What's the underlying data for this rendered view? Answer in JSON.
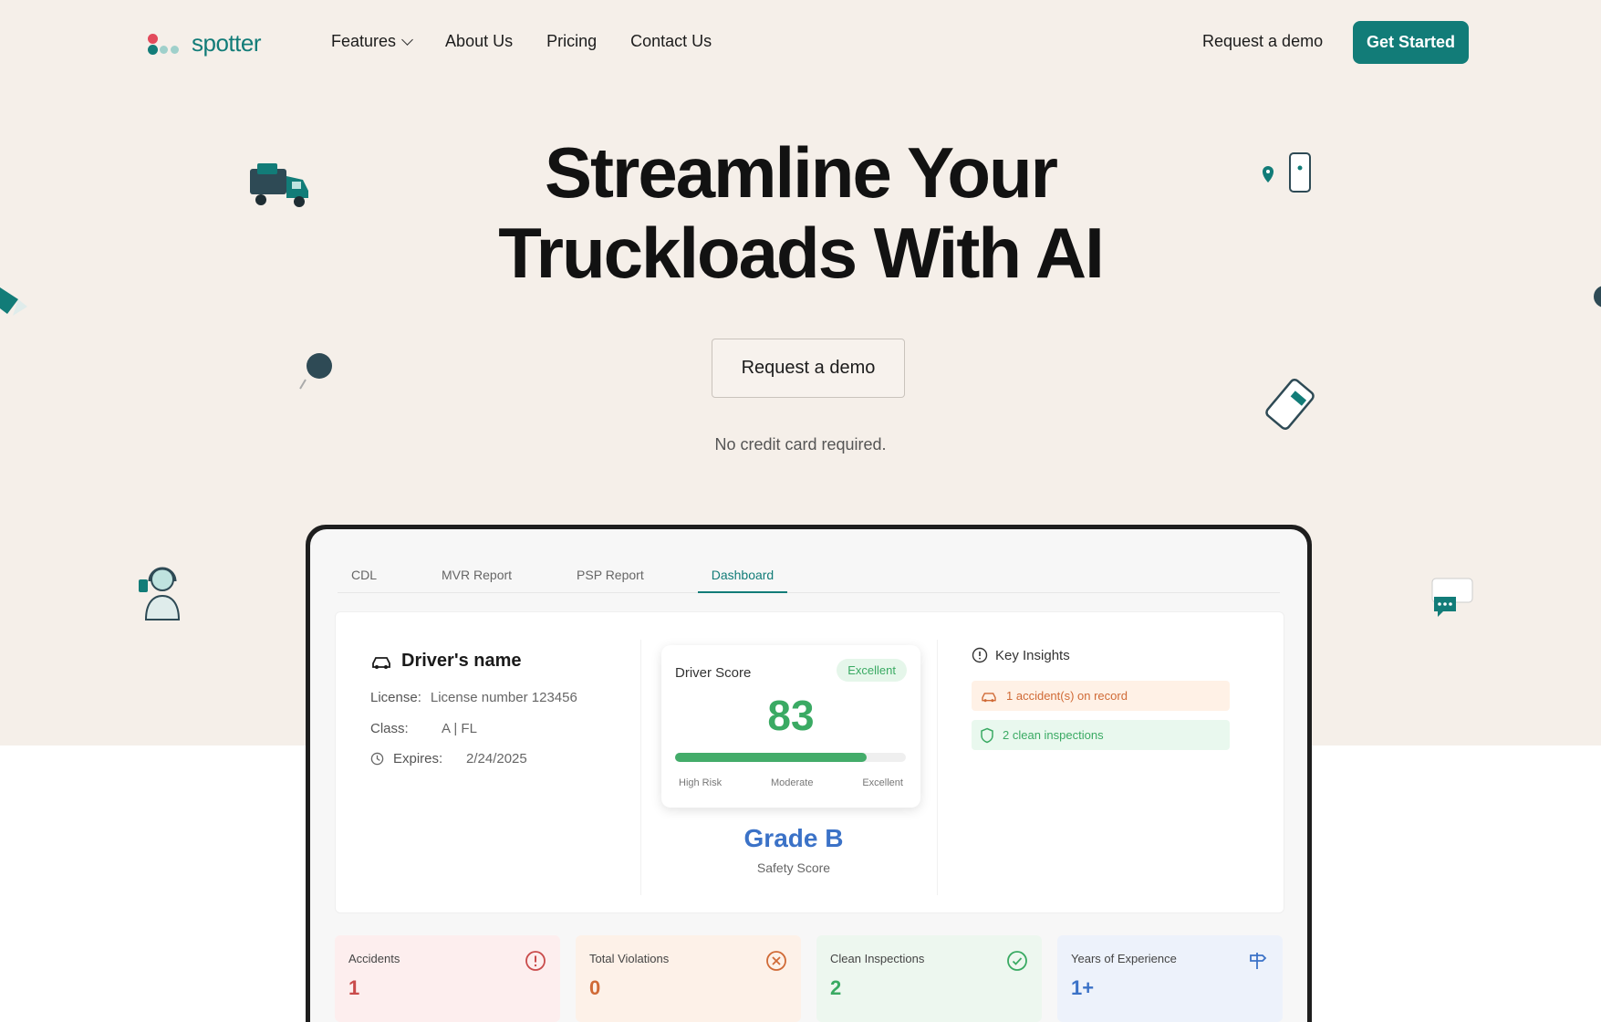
{
  "brand": {
    "name": "spotter",
    "color": "#127c78"
  },
  "nav": {
    "items": [
      {
        "label": "Features",
        "has_dropdown": true
      },
      {
        "label": "About Us"
      },
      {
        "label": "Pricing"
      },
      {
        "label": "Contact Us"
      }
    ],
    "request_demo": "Request a demo",
    "get_started": "Get Started"
  },
  "hero": {
    "title_line1": "Streamline Your",
    "title_line2": "Truckloads With AI",
    "cta": "Request a demo",
    "note": "No credit card required."
  },
  "dashboard": {
    "tabs": [
      "CDL",
      "MVR Report",
      "PSP Report",
      "Dashboard"
    ],
    "active_tab": "Dashboard",
    "driver": {
      "name": "Driver's name",
      "license_label": "License:",
      "license_value": "License number 123456",
      "class_label": "Class:",
      "class_value": "A | FL",
      "expires_label": "Expires:",
      "expires_value": "2/24/2025"
    },
    "score": {
      "title": "Driver Score",
      "badge": "Excellent",
      "value": "83",
      "progress": 0.83,
      "scale": [
        "High Risk",
        "Moderate",
        "Excellent"
      ],
      "grade": "Grade B",
      "grade_sub": "Safety Score"
    },
    "insights": {
      "title": "Key Insights",
      "items": [
        {
          "text": "1 accident(s) on record",
          "kind": "warning"
        },
        {
          "text": "2 clean inspections",
          "kind": "success"
        }
      ]
    },
    "stats": [
      {
        "label": "Accidents",
        "value": "1",
        "icon": "alert-circle-icon"
      },
      {
        "label": "Total Violations",
        "value": "0",
        "icon": "x-circle-icon"
      },
      {
        "label": "Clean Inspections",
        "value": "2",
        "icon": "check-circle-icon"
      },
      {
        "label": "Years of Experience",
        "value": "1+",
        "icon": "signpost-icon"
      }
    ]
  },
  "colors": {
    "hero_bg": "#f5efe9",
    "accent": "#127c78",
    "success": "#3aaa63",
    "warning": "#d06a36",
    "danger": "#c94b4b",
    "info": "#3b72c7"
  }
}
